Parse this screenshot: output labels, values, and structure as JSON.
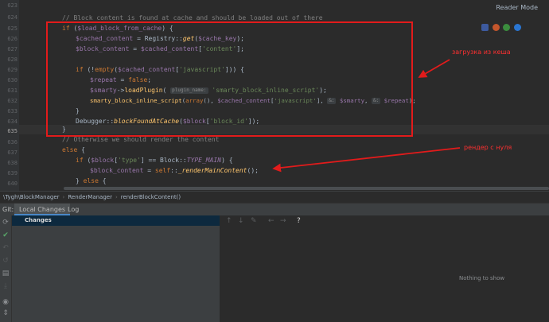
{
  "editor": {
    "reader_mode": "Reader Mode",
    "line_numbers": [
      "623",
      "624",
      "625",
      "626",
      "627",
      "628",
      "629",
      "630",
      "631",
      "632",
      "633",
      "634",
      "635",
      "636",
      "637",
      "638",
      "639",
      "640"
    ],
    "comment_top": "// Block content is found at cache and should be loaded out of there",
    "l625": {
      "kw": "if",
      "rest": " (",
      "var": "$load_block_from_cache",
      "end": ") {"
    },
    "l626": {
      "var": "$cached_content",
      "a": " = Registry::",
      "fn": "get",
      "b": "(",
      "var2": "$cache_key",
      "c": ");"
    },
    "l627": {
      "var": "$block_content",
      "a": " = ",
      "var2": "$cached_content",
      "b": "[",
      "str": "'content'",
      "c": "];"
    },
    "l629": {
      "kw": "if",
      "a": " (!",
      "fn": "empty",
      "b": "(",
      "var": "$cached_content",
      "c": "[",
      "str": "'javascript'",
      "d": "])) {"
    },
    "l630": {
      "var": "$repeat",
      "a": " = ",
      "kw": "false",
      "b": ";"
    },
    "l631": {
      "var": "$smarty",
      "a": "->",
      "fn": "loadPlugin",
      "b": "( ",
      "hint": "plugin_name:",
      "str": "'smarty_block_inline_script'",
      "c": ");"
    },
    "l632": {
      "fn": "smarty_block_inline_script",
      "a": "(",
      "kw": "array",
      "b": "(), ",
      "var": "$cached_content",
      "c": "[",
      "str": "'javascript'",
      "d": "], ",
      "hint1": "&:",
      "var2": "$smarty",
      "e": ", ",
      "hint2": "&:",
      "var3": "$repeat",
      "f": ");"
    },
    "l633": "}",
    "l634": {
      "cls": "Debugger::",
      "fn": "blockFoundAtCache",
      "a": "(",
      "var": "$block",
      "b": "[",
      "str": "'block_id'",
      "c": "]);"
    },
    "l635": "}",
    "l636": "// Otherwise we should render the content",
    "l637": {
      "kw": "else",
      "a": " {"
    },
    "l638": {
      "kw": "if",
      "a": " (",
      "var": "$block",
      "b": "[",
      "str": "'type'",
      "c": "] == Block::",
      "cst": "TYPE_MAIN",
      "d": ") {"
    },
    "l639": {
      "var": "$block_content",
      "a": " = ",
      "kw": "self",
      "b": "::",
      "fn": "_renderMainContent",
      "c": "();"
    },
    "l640": {
      "a": "} ",
      "kw": "else",
      "b": " {"
    }
  },
  "annotations": {
    "cache_label": "загрузка из кеша",
    "render_label": "рендер с нуля",
    "color": "#e21b1b"
  },
  "breadcrumb": {
    "items": [
      "\\Tygh\\BlockManager",
      "RenderManager",
      "renderBlockContent()"
    ]
  },
  "vcs": {
    "git_label": "Git:",
    "tabs": [
      "Local Changes",
      "Log"
    ],
    "changes_header": "Changes",
    "empty_text": "Nothing to show",
    "help_icon": "?"
  },
  "colors": {
    "keyword": "#cc7832",
    "variable": "#9876aa",
    "string": "#6a8759",
    "function": "#ffc66d",
    "accent": "#4a88c7"
  }
}
